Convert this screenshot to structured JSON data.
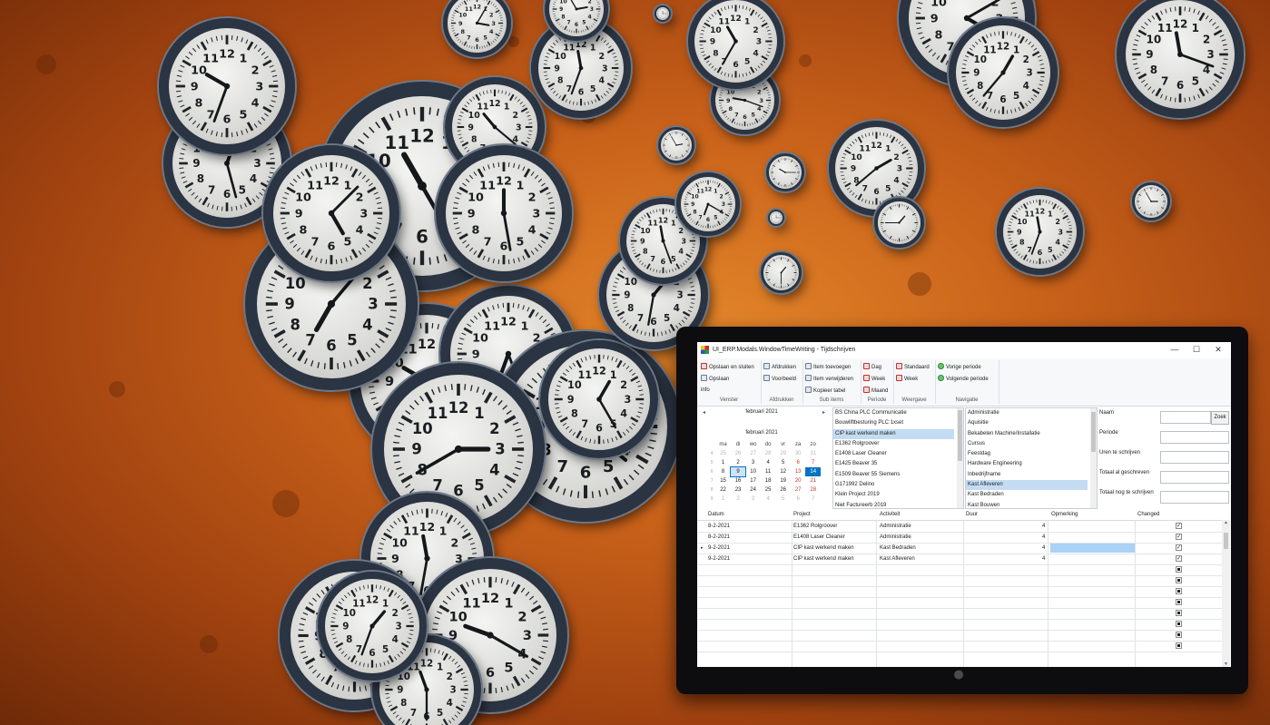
{
  "window": {
    "title": "UI_ERP.Modals.WindowTimeWriting - Tijdschrijven",
    "minimize": "—",
    "maximize": "☐",
    "close": "✕"
  },
  "ribbon": {
    "groups": [
      {
        "label": "Venster",
        "items": [
          "Opslaan en sluiten",
          "Opslaan",
          "info"
        ]
      },
      {
        "label": "Afdrukken",
        "items": [
          "Afdrukken",
          "Voorbeeld"
        ]
      },
      {
        "label": "Sub items",
        "items": [
          "Item toevoegen",
          "Item verwijderen",
          "Kopieer tabel"
        ]
      },
      {
        "label": "Periode",
        "items": [
          "Dag",
          "Week",
          "Maand"
        ]
      },
      {
        "label": "Weergave",
        "items": [
          "Standaard",
          "Week"
        ]
      },
      {
        "label": "Navigatie",
        "items": [
          "Vorige periode",
          "Volgende periode"
        ]
      }
    ]
  },
  "calendar": {
    "month_title": "februari 2021",
    "month_title_2": "februari 2021",
    "prev": "◂",
    "next": "▸",
    "weekdays": [
      "ma",
      "di",
      "wo",
      "do",
      "vr",
      "za",
      "zo"
    ],
    "weeks": [
      {
        "wk": "4",
        "days": [
          "25",
          "26",
          "27",
          "28",
          "29",
          "30",
          "31"
        ]
      },
      {
        "wk": "5",
        "days": [
          "1",
          "2",
          "3",
          "4",
          "5",
          "6",
          "7"
        ]
      },
      {
        "wk": "6",
        "days": [
          "8",
          "9",
          "10",
          "11",
          "12",
          "13",
          "14"
        ]
      },
      {
        "wk": "7",
        "days": [
          "15",
          "16",
          "17",
          "18",
          "19",
          "20",
          "21"
        ]
      },
      {
        "wk": "8",
        "days": [
          "22",
          "23",
          "24",
          "25",
          "26",
          "27",
          "28"
        ]
      },
      {
        "wk": "9",
        "days": [
          "1",
          "2",
          "3",
          "4",
          "5",
          "6",
          "7"
        ]
      }
    ],
    "today": "9",
    "selected": "14"
  },
  "projects": {
    "items": [
      "BS China PLC Communicatie",
      "Bouwliftbesturing PLC 1xset",
      "CIP kast werkend maken",
      "E1362 Rolgroover",
      "E1408 Laser Cleaner",
      "E1425 Beaver 35",
      "E1509 Beaver 55 Siemens",
      "G171992 Delino",
      "Klein Project 2019",
      "Niet Factureerb 2019"
    ],
    "selected_index": 2
  },
  "activities": {
    "items": [
      "Administratie",
      "Aquisitie",
      "Bekabelen Machine/Installatie",
      "Cursus",
      "Feestdag",
      "Hardware Engineering",
      "Inbedrijfname",
      "Kast Afleveren",
      "Kast Bedraden",
      "Kast Bouwen"
    ],
    "selected_index": 7
  },
  "form": {
    "naam_label": "Naam",
    "periode_label": "Periode",
    "uren_label": "Uren te schrijven",
    "totaal_label": "Totaal al geschreven",
    "nog_label": "Totaal nog te schrijven",
    "zoek_button": "Zoek"
  },
  "grid": {
    "columns": [
      "Datum",
      "Project",
      "Activiteit",
      "Duur",
      "Opmerking",
      "Changed"
    ],
    "rows": [
      {
        "datum": "8-2-2021",
        "project": "E1362 Rolgroover",
        "activiteit": "Administratie",
        "duur": "4",
        "opmerking": "",
        "changed": true
      },
      {
        "datum": "8-2-2021",
        "project": "E1408 Laser Cleaner",
        "activiteit": "Administratie",
        "duur": "4",
        "opmerking": "",
        "changed": true
      },
      {
        "datum": "9-2-2021",
        "project": "CIP kast werkend maken",
        "activiteit": "Kast Bedraden",
        "duur": "4",
        "opmerking": "",
        "changed": true
      },
      {
        "datum": "9-2-2021",
        "project": "CIP kast werkend maken",
        "activiteit": "Kast Afleveren",
        "duur": "4",
        "opmerking": "",
        "changed": true
      }
    ],
    "row_pointer": "▸",
    "empty_rows": 8
  },
  "colors": {
    "background_orange": "#c9621a",
    "accent_blue": "#0a72c2",
    "selection": "#c3dcf3"
  }
}
